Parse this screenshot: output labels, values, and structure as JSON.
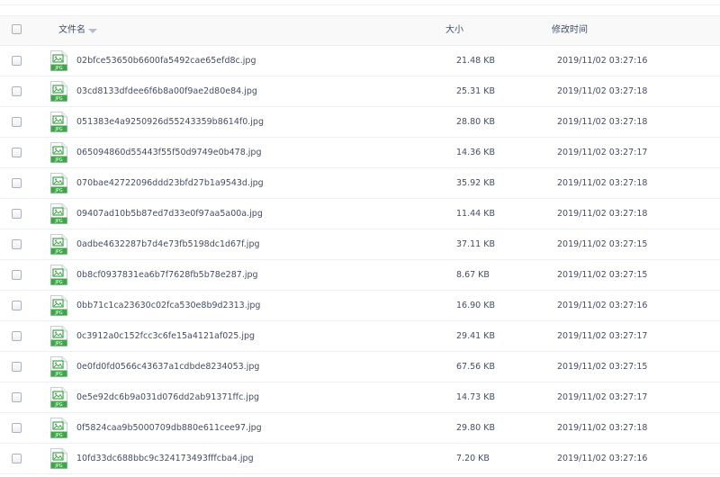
{
  "header": {
    "name_label": "文件名",
    "size_label": "大小",
    "time_label": "修改时间"
  },
  "icon": {
    "name": "jpg-file-icon",
    "color": "#3fa64a",
    "text": "JPG"
  },
  "files": [
    {
      "name": "02bfce53650b6600fa5492cae65efd8c.jpg",
      "size": "21.48 KB",
      "modified": "2019/11/02 03:27:16"
    },
    {
      "name": "03cd8133dfdee6f6b8a00f9ae2d80e84.jpg",
      "size": "25.31 KB",
      "modified": "2019/11/02 03:27:18"
    },
    {
      "name": "051383e4a9250926d55243359b8614f0.jpg",
      "size": "28.80 KB",
      "modified": "2019/11/02 03:27:18"
    },
    {
      "name": "065094860d55443f55f50d9749e0b478.jpg",
      "size": "14.36 KB",
      "modified": "2019/11/02 03:27:17"
    },
    {
      "name": "070bae42722096ddd23bfd27b1a9543d.jpg",
      "size": "35.92 KB",
      "modified": "2019/11/02 03:27:18"
    },
    {
      "name": "09407ad10b5b87ed7d33e0f97aa5a00a.jpg",
      "size": "11.44 KB",
      "modified": "2019/11/02 03:27:18"
    },
    {
      "name": "0adbe4632287b7d4e73fb5198dc1d67f.jpg",
      "size": "37.11 KB",
      "modified": "2019/11/02 03:27:15"
    },
    {
      "name": "0b8cf0937831ea6b7f7628fb5b78e287.jpg",
      "size": "8.67 KB",
      "modified": "2019/11/02 03:27:15"
    },
    {
      "name": "0bb71c1ca23630c02fca530e8b9d2313.jpg",
      "size": "16.90 KB",
      "modified": "2019/11/02 03:27:16"
    },
    {
      "name": "0c3912a0c152fcc3c6fe15a4121af025.jpg",
      "size": "29.41 KB",
      "modified": "2019/11/02 03:27:17"
    },
    {
      "name": "0e0fd0fd0566c43637a1cdbde8234053.jpg",
      "size": "67.56 KB",
      "modified": "2019/11/02 03:27:15"
    },
    {
      "name": "0e5e92dc6b9a031d076dd2ab91371ffc.jpg",
      "size": "14.73 KB",
      "modified": "2019/11/02 03:27:17"
    },
    {
      "name": "0f5824caa9b5000709db880e611cee97.jpg",
      "size": "29.80 KB",
      "modified": "2019/11/02 03:27:18"
    },
    {
      "name": "10fd33dc688bbc9c324173493fffcba4.jpg",
      "size": "7.20 KB",
      "modified": "2019/11/02 03:27:16"
    }
  ]
}
